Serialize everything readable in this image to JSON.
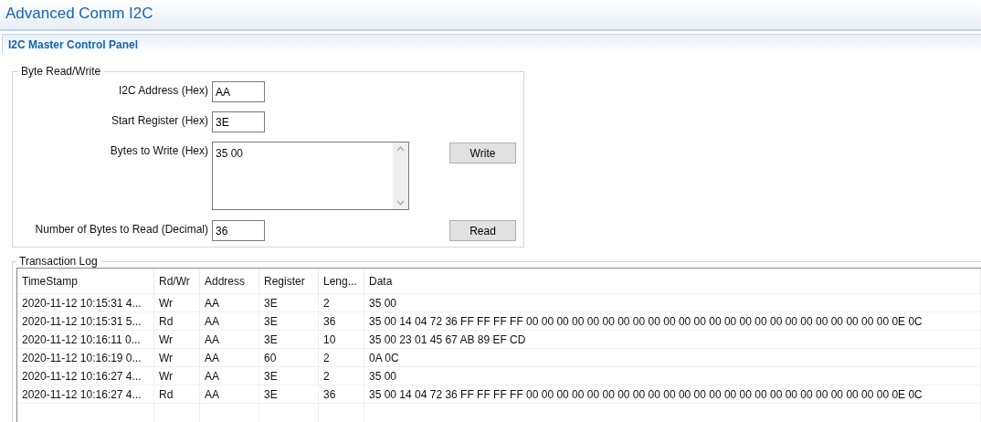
{
  "window": {
    "title": "Advanced Comm I2C"
  },
  "panel": {
    "title": "I2C Master Control Panel"
  },
  "byte_rw": {
    "legend": "Byte Read/Write",
    "fields": [
      {
        "label": "I2C Address (Hex)",
        "value": "AA",
        "kind": "input"
      },
      {
        "label": "Start Register (Hex)",
        "value": "3E",
        "kind": "input"
      },
      {
        "label": "Bytes to Write (Hex)",
        "value": "35 00",
        "kind": "textarea",
        "button": "Write"
      },
      {
        "label": "Number of Bytes to Read (Decimal)",
        "value": "36",
        "kind": "input",
        "button": "Read"
      }
    ]
  },
  "log": {
    "legend": "Transaction Log",
    "columns": [
      "TimeStamp",
      "Rd/Wr",
      "Address",
      "Register",
      "Leng...",
      "Data"
    ],
    "rows": [
      [
        "2020-11-12 10:15:31 4...",
        "Wr",
        "AA",
        "3E",
        "2",
        "35 00"
      ],
      [
        "2020-11-12 10:15:31 5...",
        "Rd",
        "AA",
        "3E",
        "36",
        "35 00 14 04 72 36 FF FF FF FF 00 00 00 00 00 00 00 00 00 00 00 00 00 00 00 00 00 00 00 00 00 00 00 00 0E 0C"
      ],
      [
        "2020-11-12 10:16:11 0...",
        "Wr",
        "AA",
        "3E",
        "10",
        "35 00 23 01 45 67 AB 89 EF CD"
      ],
      [
        "2020-11-12 10:16:19 0...",
        "Wr",
        "AA",
        "60",
        "2",
        "0A 0C"
      ],
      [
        "2020-11-12 10:16:27 4...",
        "Wr",
        "AA",
        "3E",
        "2",
        "35 00"
      ],
      [
        "2020-11-12 10:16:27 4...",
        "Rd",
        "AA",
        "3E",
        "36",
        "35 00 14 04 72 36 FF FF FF FF 00 00 00 00 00 00 00 00 00 00 00 00 00 00 00 00 00 00 00 00 00 00 00 00 0E 0C"
      ]
    ]
  }
}
